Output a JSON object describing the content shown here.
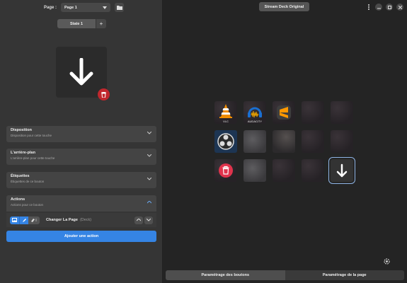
{
  "left": {
    "page_label": "Page :",
    "page_select": "Page 1",
    "state_label": "State 1",
    "state_add": "+",
    "sections": [
      {
        "title": "Disposition",
        "subtitle": "Disposition pour cette touche"
      },
      {
        "title": "L'arrière-plan",
        "subtitle": "L'arrière-plan pour cette touche"
      },
      {
        "title": "Étiquettes",
        "subtitle": "Étiquettes de ce bouton"
      },
      {
        "title": "Actions",
        "subtitle": "Actions pour ce bouton"
      }
    ],
    "action": {
      "name": "Changer La Page",
      "source": "(Deck)"
    },
    "add_action": "Ajouter une action"
  },
  "right": {
    "deck_name": "Stream Deck Original",
    "keys": [
      {
        "icon": "vlc-icon",
        "label": "VLC"
      },
      {
        "icon": "audacity-icon",
        "label": "AUDACITY"
      },
      {
        "icon": "sublime-text-icon",
        "label": ""
      },
      {
        "icon": "background-image",
        "label": ""
      },
      {
        "icon": "background-image",
        "label": ""
      },
      {
        "icon": "obs-icon",
        "label": ""
      },
      {
        "icon": "background-image",
        "label": ""
      },
      {
        "icon": "background-image",
        "label": ""
      },
      {
        "icon": "background-image",
        "label": ""
      },
      {
        "icon": "background-image",
        "label": ""
      },
      {
        "icon": "trash-icon",
        "label": ""
      },
      {
        "icon": "background-image",
        "label": ""
      },
      {
        "icon": "background-image",
        "label": ""
      },
      {
        "icon": "background-image",
        "label": ""
      },
      {
        "icon": "arrow-down-icon",
        "label": ""
      }
    ],
    "tabs": [
      "Paramétrage des boutons",
      "Paramétrage de la page"
    ]
  },
  "colors": {
    "accent": "#3584e4",
    "danger": "#c0272d",
    "selected_outline": "#8fb4e6"
  }
}
